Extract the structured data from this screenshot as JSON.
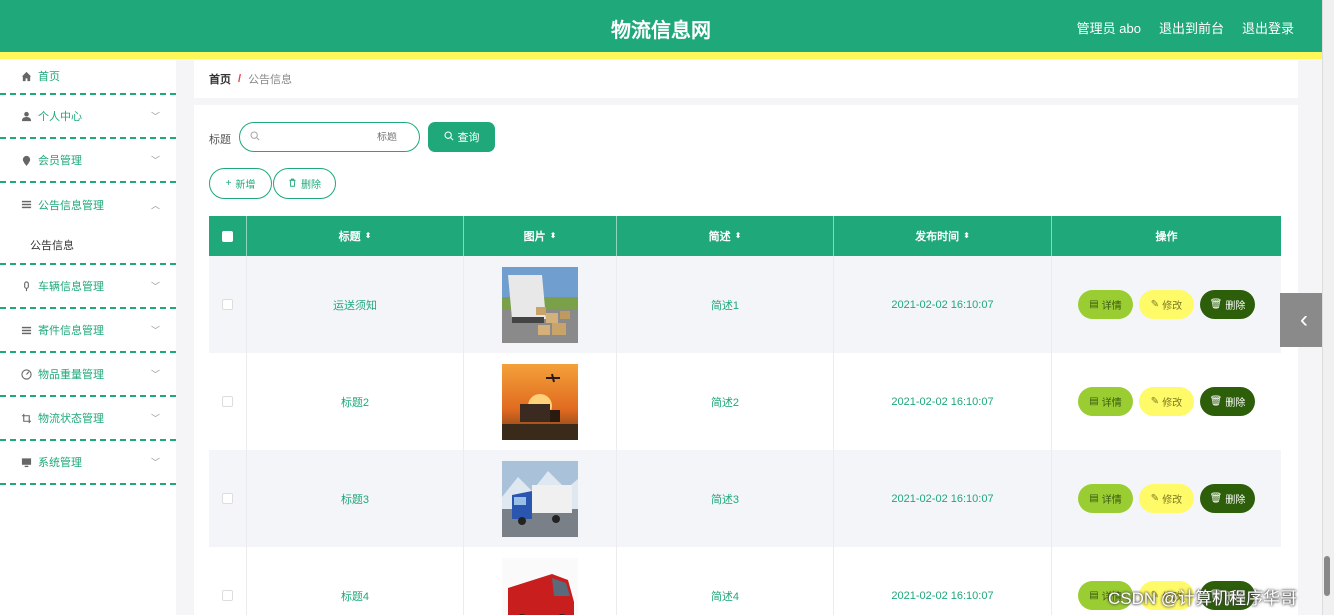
{
  "header": {
    "title": "物流信息网",
    "user": "管理员 abo",
    "back_front": "退出到前台",
    "logout": "退出登录"
  },
  "sidebar": {
    "items": [
      {
        "label": "首页",
        "icon": "home-icon"
      },
      {
        "label": "个人中心",
        "icon": "user-icon"
      },
      {
        "label": "会员管理",
        "icon": "pin-icon"
      },
      {
        "label": "公告信息管理",
        "icon": "menu-icon"
      },
      {
        "label": "公告信息",
        "icon": ""
      },
      {
        "label": "车辆信息管理",
        "icon": "mic-icon"
      },
      {
        "label": "寄件信息管理",
        "icon": "list-icon"
      },
      {
        "label": "物品重量管理",
        "icon": "compass-icon"
      },
      {
        "label": "物流状态管理",
        "icon": "crop-icon"
      },
      {
        "label": "系统管理",
        "icon": "monitor-icon"
      }
    ]
  },
  "breadcrumb": {
    "home": "首页",
    "sep": "/",
    "current": "公告信息"
  },
  "search": {
    "label": "标题",
    "placeholder": "标题",
    "button": "查询"
  },
  "actions": {
    "add": "新增",
    "delete": "删除"
  },
  "table": {
    "headers": [
      "标题",
      "图片",
      "简述",
      "发布时间",
      "操作"
    ],
    "rows": [
      {
        "title": "运送须知",
        "desc": "简述1",
        "time": "2021-02-02 16:10:07",
        "image": "truck-unloading"
      },
      {
        "title": "标题2",
        "desc": "简述2",
        "time": "2021-02-02 16:10:07",
        "image": "truck-sunset-plane"
      },
      {
        "title": "标题3",
        "desc": "简述3",
        "time": "2021-02-02 16:10:07",
        "image": "blue-truck-mountains"
      },
      {
        "title": "标题4",
        "desc": "简述4",
        "time": "2021-02-02 16:10:07",
        "image": "red-van"
      }
    ],
    "ops": {
      "detail": "详情",
      "edit": "修改",
      "delete": "删除"
    }
  },
  "watermark": "CSDN @计算机程序华哥",
  "colors": {
    "primary": "#1fa87a",
    "accent_bar": "#fff65a",
    "detail": "#9acd32",
    "edit": "#fffa68",
    "danger": "#2d5e0a"
  }
}
